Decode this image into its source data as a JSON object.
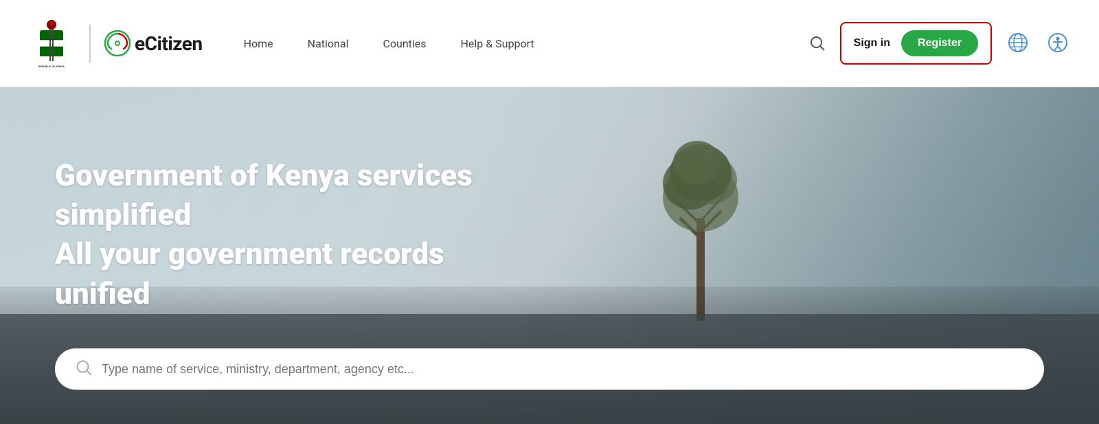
{
  "header": {
    "site_name": "eCitizen",
    "nav": {
      "home": "Home",
      "national": "National",
      "counties": "Counties",
      "help_support": "Help & Support"
    },
    "auth": {
      "signin": "Sign in",
      "register": "Register"
    }
  },
  "hero": {
    "title_line1": "Government of Kenya services simplified",
    "title_line2": "All your government records unified"
  },
  "search": {
    "placeholder": "Type name of service, ministry, department, agency etc..."
  }
}
